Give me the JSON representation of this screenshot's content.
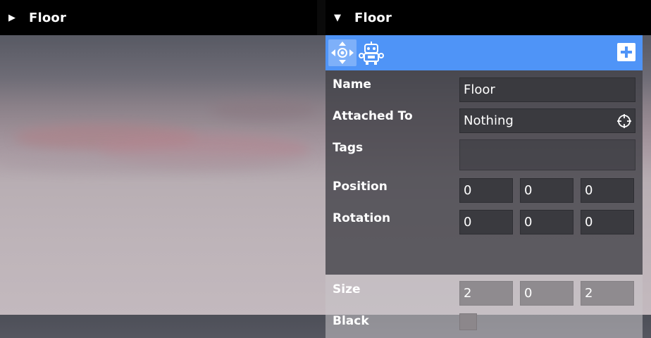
{
  "left_header": {
    "arrow": "▶",
    "title": "Floor"
  },
  "right_header": {
    "arrow": "▼",
    "title": "Floor"
  },
  "toolbar": {
    "add_label": "+"
  },
  "properties": {
    "name": {
      "label": "Name",
      "value": "Floor"
    },
    "attached_to": {
      "label": "Attached To",
      "value": "Nothing"
    },
    "tags": {
      "label": "Tags",
      "value": ""
    },
    "position": {
      "label": "Position",
      "x": "0",
      "y": "0",
      "z": "0"
    },
    "rotation": {
      "label": "Rotation",
      "x": "0",
      "y": "0",
      "z": "0"
    },
    "size": {
      "label": "Size",
      "x": "2",
      "y": "0",
      "z": "2"
    },
    "black": {
      "label": "Black",
      "color": "#8c878b"
    }
  },
  "colors": {
    "toolbar": "#4f94f7",
    "header": "#000000"
  }
}
